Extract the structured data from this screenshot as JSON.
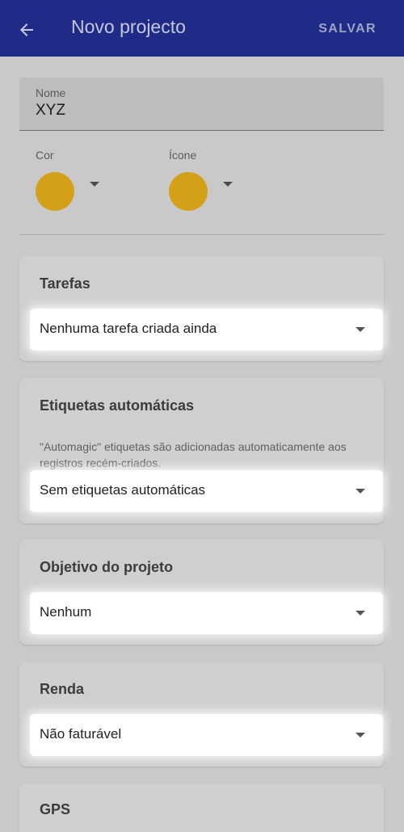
{
  "appbar": {
    "back_icon": "arrow-left-icon",
    "title": "Novo projecto",
    "save_label": "SALVAR"
  },
  "name_field": {
    "label": "Nome",
    "value": "XYZ"
  },
  "color_picker": {
    "label": "Cor",
    "color": "#d4a017"
  },
  "icon_picker": {
    "label": "Ícone",
    "color": "#d4a017"
  },
  "sections": {
    "tasks": {
      "title": "Tarefas",
      "selected": "Nenhuma tarefa criada ainda"
    },
    "auto_tags": {
      "title": "Etiquetas automáticas",
      "description": "\"Automagic\" etiquetas são adicionadas automaticamente aos registros recém-criados.",
      "selected": "Sem etiquetas automáticas"
    },
    "goal": {
      "title": "Objetivo do projeto",
      "selected": "Nenhum"
    },
    "income": {
      "title": "Renda",
      "selected": "Não faturável"
    },
    "gps": {
      "title": "GPS"
    }
  },
  "colors": {
    "appbar": "#1f2b86",
    "accent_swatch": "#d4a017",
    "background": "#c9c9c9"
  }
}
